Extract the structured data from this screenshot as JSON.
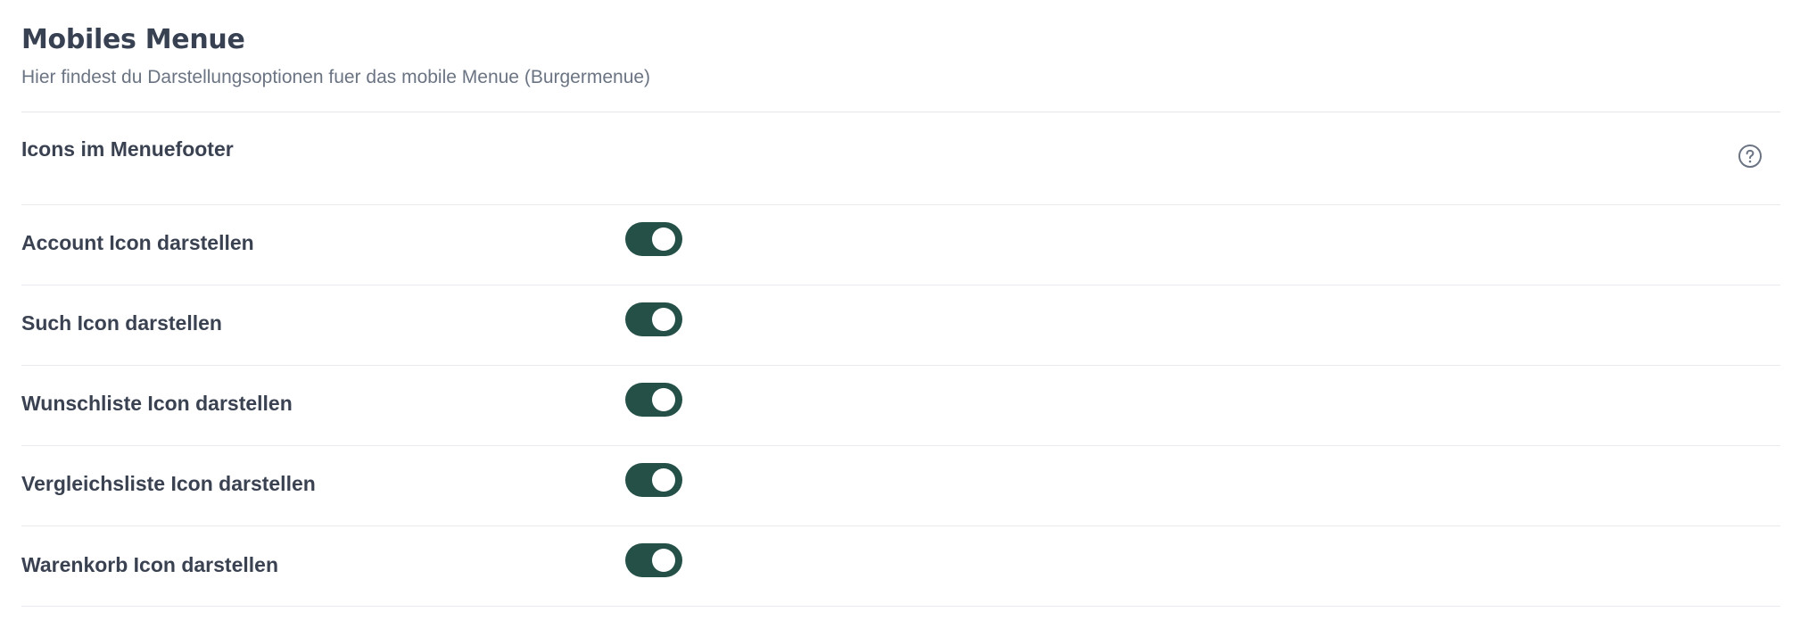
{
  "header": {
    "title": "Mobiles Menue",
    "subtitle": "Hier findest du Darstellungsoptionen fuer das mobile Menue (Burgermenue)"
  },
  "section": {
    "label": "Icons im Menuefooter",
    "help_icon": "question-circle-icon"
  },
  "colors": {
    "toggle_on": "#245048",
    "text": "#3a4252",
    "muted": "#6b7483"
  },
  "settings": [
    {
      "label": "Account Icon darstellen",
      "enabled": true
    },
    {
      "label": "Such Icon darstellen",
      "enabled": true
    },
    {
      "label": "Wunschliste Icon darstellen",
      "enabled": true
    },
    {
      "label": "Vergleichsliste Icon darstellen",
      "enabled": true
    },
    {
      "label": "Warenkorb Icon darstellen",
      "enabled": true
    }
  ]
}
